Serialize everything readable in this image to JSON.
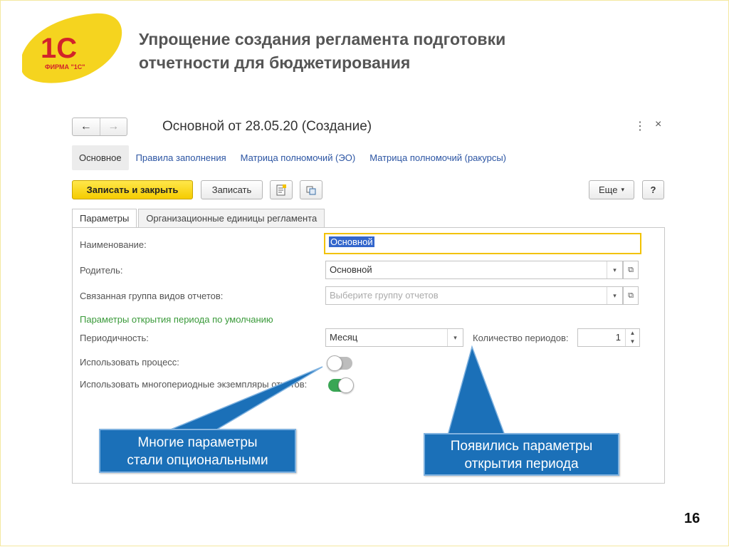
{
  "slide": {
    "title_line1": "Упрощение создания регламента подготовки",
    "title_line2": "отчетности для  бюджетирования",
    "page_number": "16",
    "logo": {
      "mark": "1С",
      "caption": "ФИРМА \"1С\"",
      "icon": "1c-logo-icon",
      "color": "#f5d41f"
    }
  },
  "window": {
    "back_icon": "back-arrow-icon",
    "forward_icon": "forward-arrow-icon",
    "title": "Основной  от 28.05.20  (Создание)",
    "more_glyph": "⋮",
    "close_glyph": "×"
  },
  "links": {
    "active": "Основное",
    "items": [
      "Правила заполнения",
      "Матрица полномочий (ЭО)",
      "Матрица полномочий (ракурсы)"
    ]
  },
  "toolbar": {
    "save_close": "Записать и закрыть",
    "save": "Записать",
    "more": "Еще",
    "help": "?"
  },
  "tabs": [
    "Параметры",
    "Организационные единицы регламента"
  ],
  "form": {
    "name_label": "Наименование:",
    "name_value": "Основной",
    "parent_label": "Родитель:",
    "parent_value": "Основной",
    "group_label": "Связанная группа видов отчетов:",
    "group_placeholder": "Выберите группу отчетов",
    "section_title": "Параметры открытия периода  по умолчанию",
    "periodicity_label": "Периодичность:",
    "periodicity_value": "Месяц",
    "periods_count_label": "Количество периодов:",
    "periods_count_value": "1",
    "use_process_label": "Использовать процесс:",
    "use_process_on": false,
    "use_multi_label": "Использовать многопериодные экземпляры отчетов:",
    "use_multi_on": true
  },
  "callouts": {
    "left_line1": "Многие параметры",
    "left_line2": "стали опциональными",
    "right_line1": "Появились параметры",
    "right_line2": "открытия периода",
    "color": "#1b70b8"
  }
}
